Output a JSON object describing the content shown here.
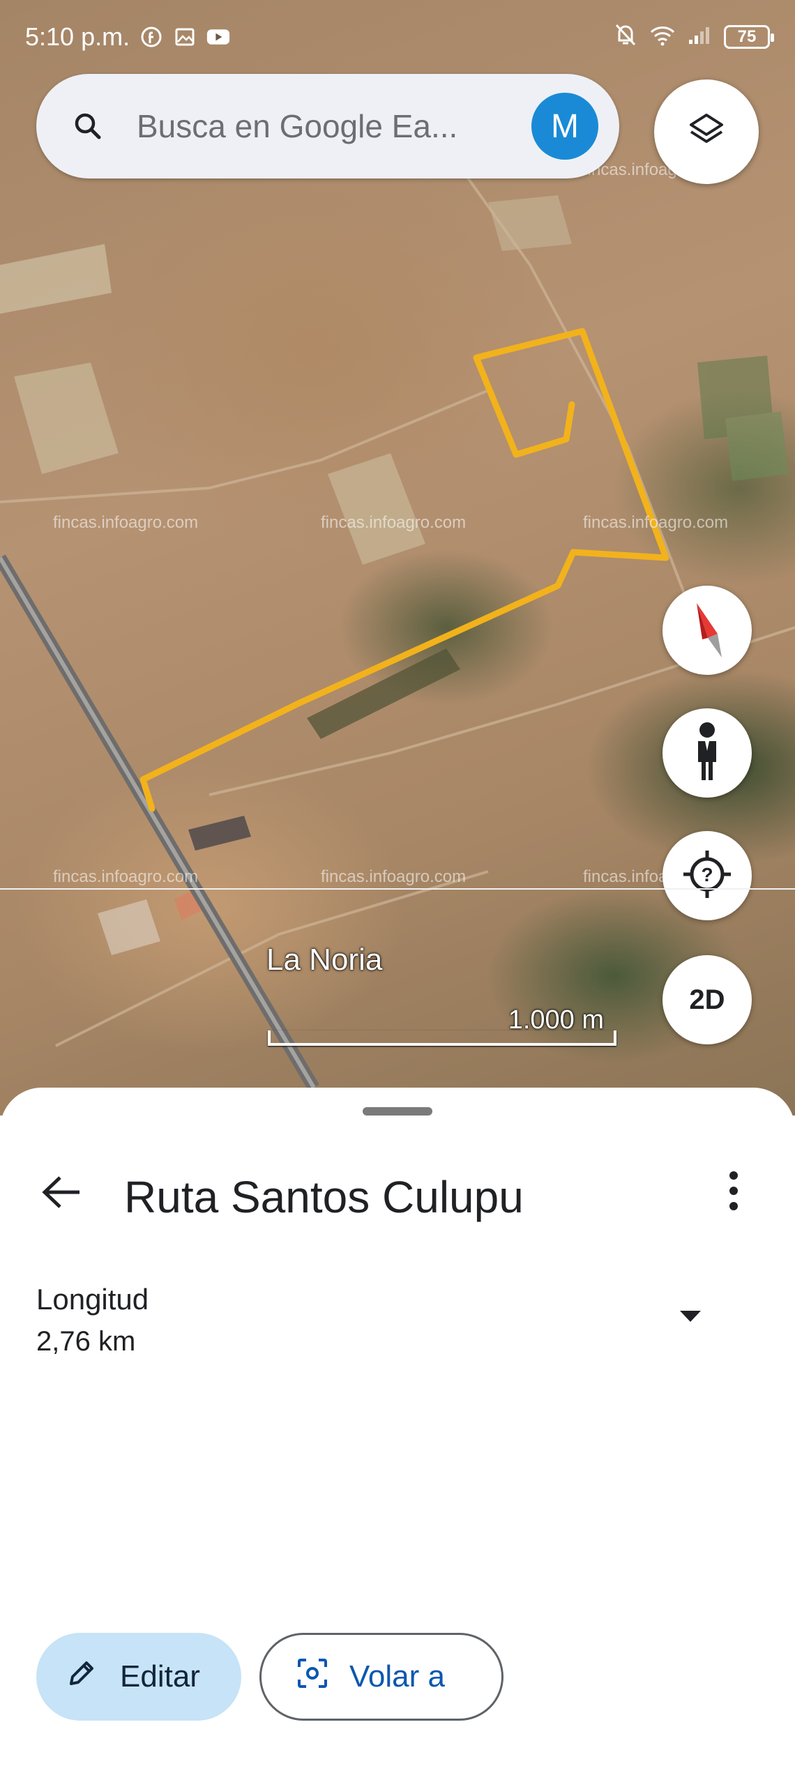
{
  "status_bar": {
    "time": "5:10 p.m.",
    "battery": "75",
    "left_icons": [
      "facebook-icon",
      "gallery-icon",
      "youtube-icon"
    ],
    "right_icons": [
      "bell-off-icon",
      "wifi-icon",
      "signal-icon",
      "battery-icon"
    ]
  },
  "search": {
    "placeholder": "Busca en Google Ea...",
    "avatar_letter": "M"
  },
  "map": {
    "place_label": "La Noria",
    "scale_label": "1.000 m",
    "watermark": "fincas.infoagro.com",
    "mode_label": "2D",
    "route_color": "#f2b21c"
  },
  "sheet": {
    "title": "Ruta Santos Culupu",
    "length_label": "Longitud",
    "length_value": "2,76 km"
  },
  "actions": {
    "edit_label": "Editar",
    "fly_label": "Volar a"
  },
  "colors": {
    "accent": "#1a8ad6",
    "edit_bg": "#c7e3f7",
    "fly_text": "#0b57b0"
  }
}
